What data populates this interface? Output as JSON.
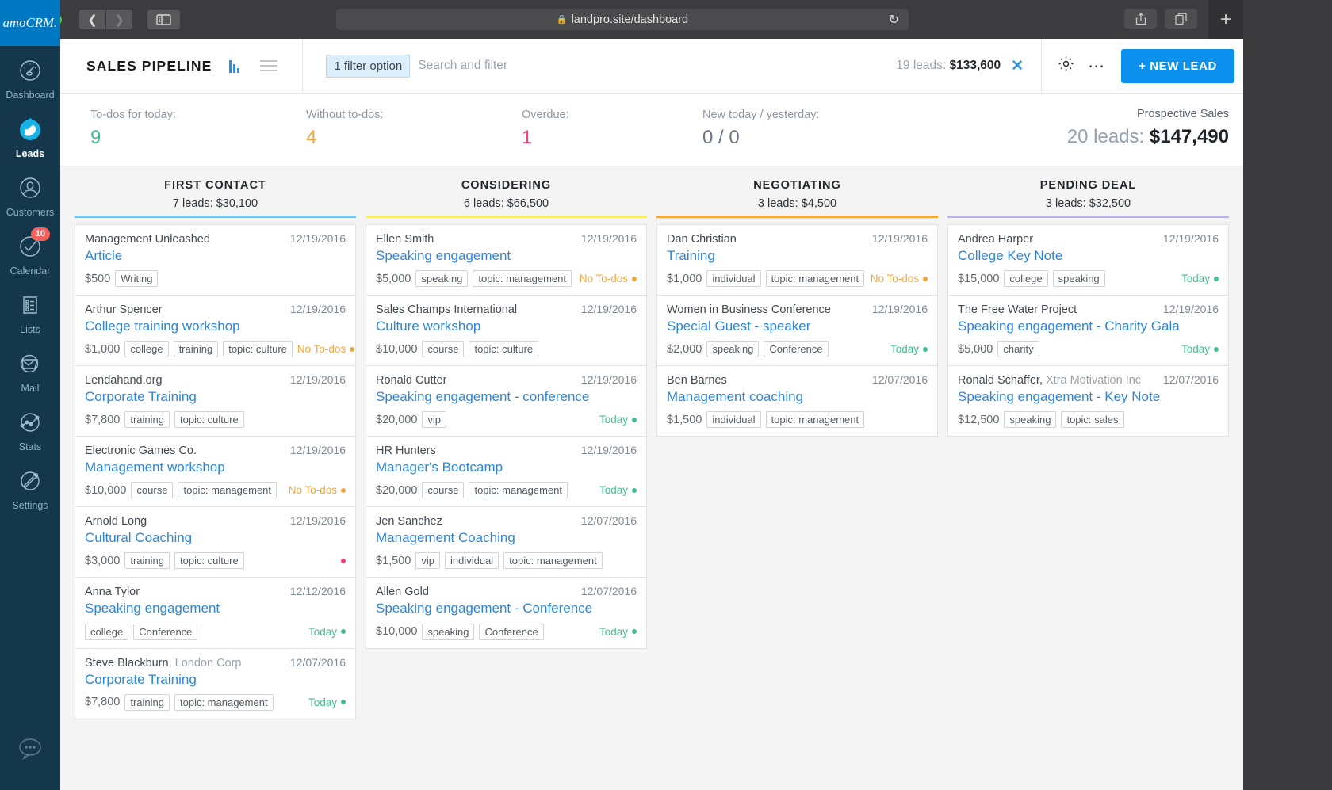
{
  "browser": {
    "url": "landpro.site/dashboard",
    "lock_icon": "lock-icon",
    "back_icon": "chevron-left-icon",
    "forward_icon": "chevron-right-icon",
    "sidebar_icon": "sidebar-toggle-icon",
    "reload_icon": "reload-icon",
    "share_icon": "share-icon",
    "tabs_icon": "show-tabs-icon",
    "newtab_label": "+"
  },
  "sidebar": {
    "logo": "amoCRM.",
    "items": [
      {
        "label": "Dashboard",
        "icon": "speedometer-icon",
        "active": false,
        "badge": ""
      },
      {
        "label": "Leads",
        "icon": "leads-icon",
        "active": true,
        "badge": ""
      },
      {
        "label": "Customers",
        "icon": "customers-icon",
        "active": false,
        "badge": ""
      },
      {
        "label": "Calendar",
        "icon": "check-circle-icon",
        "active": false,
        "badge": "10"
      },
      {
        "label": "Lists",
        "icon": "list-icon",
        "active": false,
        "badge": ""
      },
      {
        "label": "Mail",
        "icon": "mail-icon",
        "active": false,
        "badge": ""
      },
      {
        "label": "Stats",
        "icon": "stats-icon",
        "active": false,
        "badge": ""
      },
      {
        "label": "Settings",
        "icon": "wrench-icon",
        "active": false,
        "badge": ""
      }
    ],
    "chat_icon": "chat-bubble-icon"
  },
  "header": {
    "title": "SALES PIPELINE",
    "pipeline_icon": "pipeline-view-icon",
    "list_icon": "list-view-icon",
    "filter_chip": "1 filter option",
    "search_placeholder": "Search and filter",
    "leads_count_label": "19 leads: ",
    "leads_total": "$133,600",
    "clear_icon": "close-icon",
    "gear_icon": "gear-icon",
    "more_icon": "more-dots-icon",
    "new_lead_label": "+ NEW LEAD"
  },
  "stats": {
    "items": [
      {
        "label": "To-dos for today:",
        "value": "9",
        "color": "#3fbf8f"
      },
      {
        "label": "Without to-dos:",
        "value": "4",
        "color": "#f2a73b"
      },
      {
        "label": "Overdue:",
        "value": "1",
        "color": "#f1427e"
      },
      {
        "label": "New today / yesterday:",
        "value": "0 / 0",
        "color": "#6b7684"
      }
    ],
    "prospective_label": "Prospective Sales",
    "prospective_leads": "20 leads: ",
    "prospective_value": "$147,490"
  },
  "colors": {
    "accent_blue": "#0b90ed",
    "link_blue": "#2e86d8",
    "col_first_contact": "#79c5f2",
    "col_considering": "#f7e96b",
    "col_negotiating": "#f3a63c",
    "col_pending": "#b7b2e8",
    "status_today": "#3fbf8f",
    "status_no_todos": "#f2a73b",
    "status_overdue": "#f1427e"
  },
  "board": {
    "columns": [
      {
        "name": "FIRST CONTACT",
        "summary": "7 leads: $30,100",
        "rule_color": "#79c5f2",
        "cards": [
          {
            "contact": "Management Unleashed",
            "company": "",
            "date": "12/19/2016",
            "title": "Article",
            "price": "$500",
            "tags": [
              "Writing"
            ],
            "status": "",
            "status_color": "",
            "dot": ""
          },
          {
            "contact": "Arthur Spencer",
            "company": "",
            "date": "12/19/2016",
            "title": "College training workshop",
            "price": "$1,000",
            "tags": [
              "college",
              "training",
              "topic: culture"
            ],
            "status": "No To-dos",
            "status_color": "#f2a73b",
            "dot": "#f2a73b"
          },
          {
            "contact": "Lendahand.org",
            "company": "",
            "date": "12/19/2016",
            "title": "Corporate Training",
            "price": "$7,800",
            "tags": [
              "training",
              "topic: culture"
            ],
            "status": "",
            "status_color": "",
            "dot": ""
          },
          {
            "contact": "Electronic Games Co.",
            "company": "",
            "date": "12/19/2016",
            "title": "Management workshop",
            "price": "$10,000",
            "tags": [
              "course",
              "topic: management"
            ],
            "status": "No To-dos",
            "status_color": "#f2a73b",
            "dot": "#f2a73b"
          },
          {
            "contact": "Arnold Long",
            "company": "",
            "date": "12/19/2016",
            "title": "Cultural Coaching",
            "price": "$3,000",
            "tags": [
              "training",
              "topic: culture"
            ],
            "status": "",
            "status_color": "",
            "dot": "#f1427e"
          },
          {
            "contact": "Anna Tylor",
            "company": "",
            "date": "12/12/2016",
            "title": "Speaking engagement",
            "price": "",
            "tags": [
              "college",
              "Conference"
            ],
            "status": "Today",
            "status_color": "#3fbf8f",
            "dot": "#3fbf8f"
          },
          {
            "contact": "Steve Blackburn,",
            "company": " London Corp",
            "date": "12/07/2016",
            "title": "Corporate Training",
            "price": "$7,800",
            "tags": [
              "training",
              "topic: management"
            ],
            "status": "Today",
            "status_color": "#3fbf8f",
            "dot": "#3fbf8f"
          }
        ]
      },
      {
        "name": "CONSIDERING",
        "summary": "6 leads: $66,500",
        "rule_color": "#f7e96b",
        "cards": [
          {
            "contact": "Ellen Smith",
            "company": "",
            "date": "12/19/2016",
            "title": "Speaking engagement",
            "price": "$5,000",
            "tags": [
              "speaking",
              "topic: management"
            ],
            "status": "No To-dos",
            "status_color": "#f2a73b",
            "dot": "#f2a73b"
          },
          {
            "contact": "Sales Champs International",
            "company": "",
            "date": "12/19/2016",
            "title": "Culture workshop",
            "price": "$10,000",
            "tags": [
              "course",
              "topic: culture"
            ],
            "status": "",
            "status_color": "",
            "dot": ""
          },
          {
            "contact": "Ronald Cutter",
            "company": "",
            "date": "12/19/2016",
            "title": "Speaking engagement - conference",
            "price": "$20,000",
            "tags": [
              "vip"
            ],
            "status": "Today",
            "status_color": "#3fbf8f",
            "dot": "#3fbf8f"
          },
          {
            "contact": "HR Hunters",
            "company": "",
            "date": "12/19/2016",
            "title": "Manager's Bootcamp",
            "price": "$20,000",
            "tags": [
              "course",
              "topic: management"
            ],
            "status": "Today",
            "status_color": "#3fbf8f",
            "dot": "#3fbf8f"
          },
          {
            "contact": "Jen Sanchez",
            "company": "",
            "date": "12/07/2016",
            "title": "Management Coaching",
            "price": "$1,500",
            "tags": [
              "vip",
              "individual",
              "topic: management"
            ],
            "status": "",
            "status_color": "",
            "dot": ""
          },
          {
            "contact": "Allen Gold",
            "company": "",
            "date": "12/07/2016",
            "title": "Speaking engagement - Conference",
            "price": "$10,000",
            "tags": [
              "speaking",
              "Conference"
            ],
            "status": "Today",
            "status_color": "#3fbf8f",
            "dot": "#3fbf8f"
          }
        ]
      },
      {
        "name": "NEGOTIATING",
        "summary": "3 leads: $4,500",
        "rule_color": "#f3a63c",
        "cards": [
          {
            "contact": "Dan Christian",
            "company": "",
            "date": "12/19/2016",
            "title": "Training",
            "price": "$1,000",
            "tags": [
              "individual",
              "topic: management"
            ],
            "status": "No To-dos",
            "status_color": "#f2a73b",
            "dot": "#f2a73b"
          },
          {
            "contact": "Women in Business Conference",
            "company": "",
            "date": "12/19/2016",
            "title": "Special Guest - speaker",
            "price": "$2,000",
            "tags": [
              "speaking",
              "Conference"
            ],
            "status": "Today",
            "status_color": "#3fbf8f",
            "dot": "#3fbf8f"
          },
          {
            "contact": "Ben Barnes",
            "company": "",
            "date": "12/07/2016",
            "title": "Management coaching",
            "price": "$1,500",
            "tags": [
              "individual",
              "topic: management"
            ],
            "status": "",
            "status_color": "",
            "dot": ""
          }
        ]
      },
      {
        "name": "PENDING DEAL",
        "summary": "3 leads: $32,500",
        "rule_color": "#b7b2e8",
        "cards": [
          {
            "contact": "Andrea Harper",
            "company": "",
            "date": "12/19/2016",
            "title": "College Key Note",
            "price": "$15,000",
            "tags": [
              "college",
              "speaking"
            ],
            "status": "Today",
            "status_color": "#3fbf8f",
            "dot": "#3fbf8f"
          },
          {
            "contact": "The Free Water Project",
            "company": "",
            "date": "12/19/2016",
            "title": "Speaking engagement - Charity Gala",
            "price": "$5,000",
            "tags": [
              "charity"
            ],
            "status": "Today",
            "status_color": "#3fbf8f",
            "dot": "#3fbf8f"
          },
          {
            "contact": "Ronald Schaffer,",
            "company": " Xtra Motivation Inc",
            "date": "12/07/2016",
            "title": "Speaking engagement - Key Note",
            "price": "$12,500",
            "tags": [
              "speaking",
              "topic: sales"
            ],
            "status": "",
            "status_color": "",
            "dot": ""
          }
        ]
      }
    ]
  }
}
